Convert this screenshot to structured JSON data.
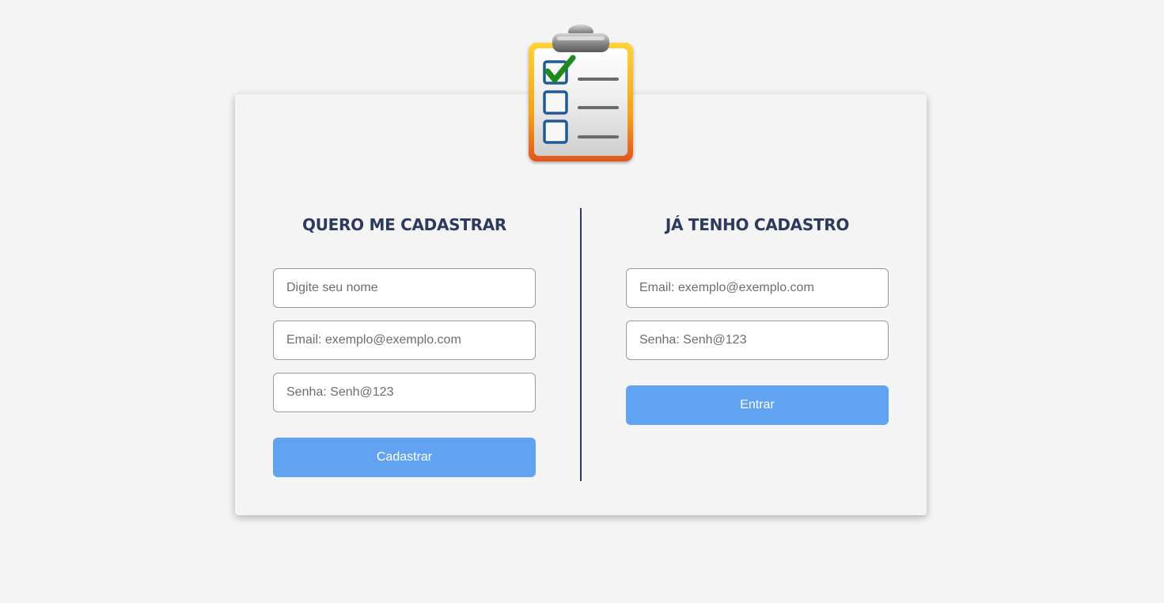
{
  "colors": {
    "background": "#f4f4f4",
    "heading": "#2d3a5c",
    "button": "#61a3f1",
    "divider": "#2d3a5c"
  },
  "logo": {
    "icon": "clipboard-checklist-icon"
  },
  "register": {
    "title": "QUERO ME CADASTRAR",
    "name_placeholder": "Digite seu nome",
    "email_placeholder": "Email: exemplo@exemplo.com",
    "password_placeholder": "Senha: Senh@123",
    "button_label": "Cadastrar"
  },
  "login": {
    "title": "JÁ TENHO CADASTRO",
    "email_placeholder": "Email: exemplo@exemplo.com",
    "password_placeholder": "Senha: Senh@123",
    "button_label": "Entrar"
  }
}
